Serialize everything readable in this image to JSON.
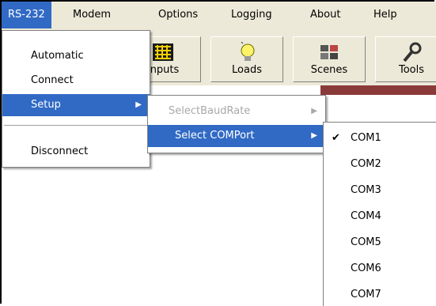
{
  "menubar": {
    "items": [
      "RS-232",
      "Modem",
      "Options",
      "Logging",
      "About",
      "Help"
    ]
  },
  "toolbar": {
    "buttons": [
      {
        "label": "nputs",
        "icon": "grid-icon"
      },
      {
        "label": "Loads",
        "icon": "bulb-icon"
      },
      {
        "label": "Scenes",
        "icon": "scenes-icon"
      },
      {
        "label": "Tools",
        "icon": "wrench-icon"
      }
    ]
  },
  "rs232_menu": {
    "items": [
      "Automatic",
      "Connect",
      "Setup",
      "Disconnect"
    ]
  },
  "setup_menu": {
    "items": [
      "SelectBaudRate",
      "Select COMPort"
    ]
  },
  "comport_menu": {
    "selected": "COM1",
    "items": [
      "COM1",
      "COM2",
      "COM3",
      "COM4",
      "COM5",
      "COM6",
      "COM7"
    ]
  },
  "colors": {
    "highlight": "#316ac5",
    "menubar_bg": "#ece9d8",
    "disabled": "#a8a8a8"
  }
}
